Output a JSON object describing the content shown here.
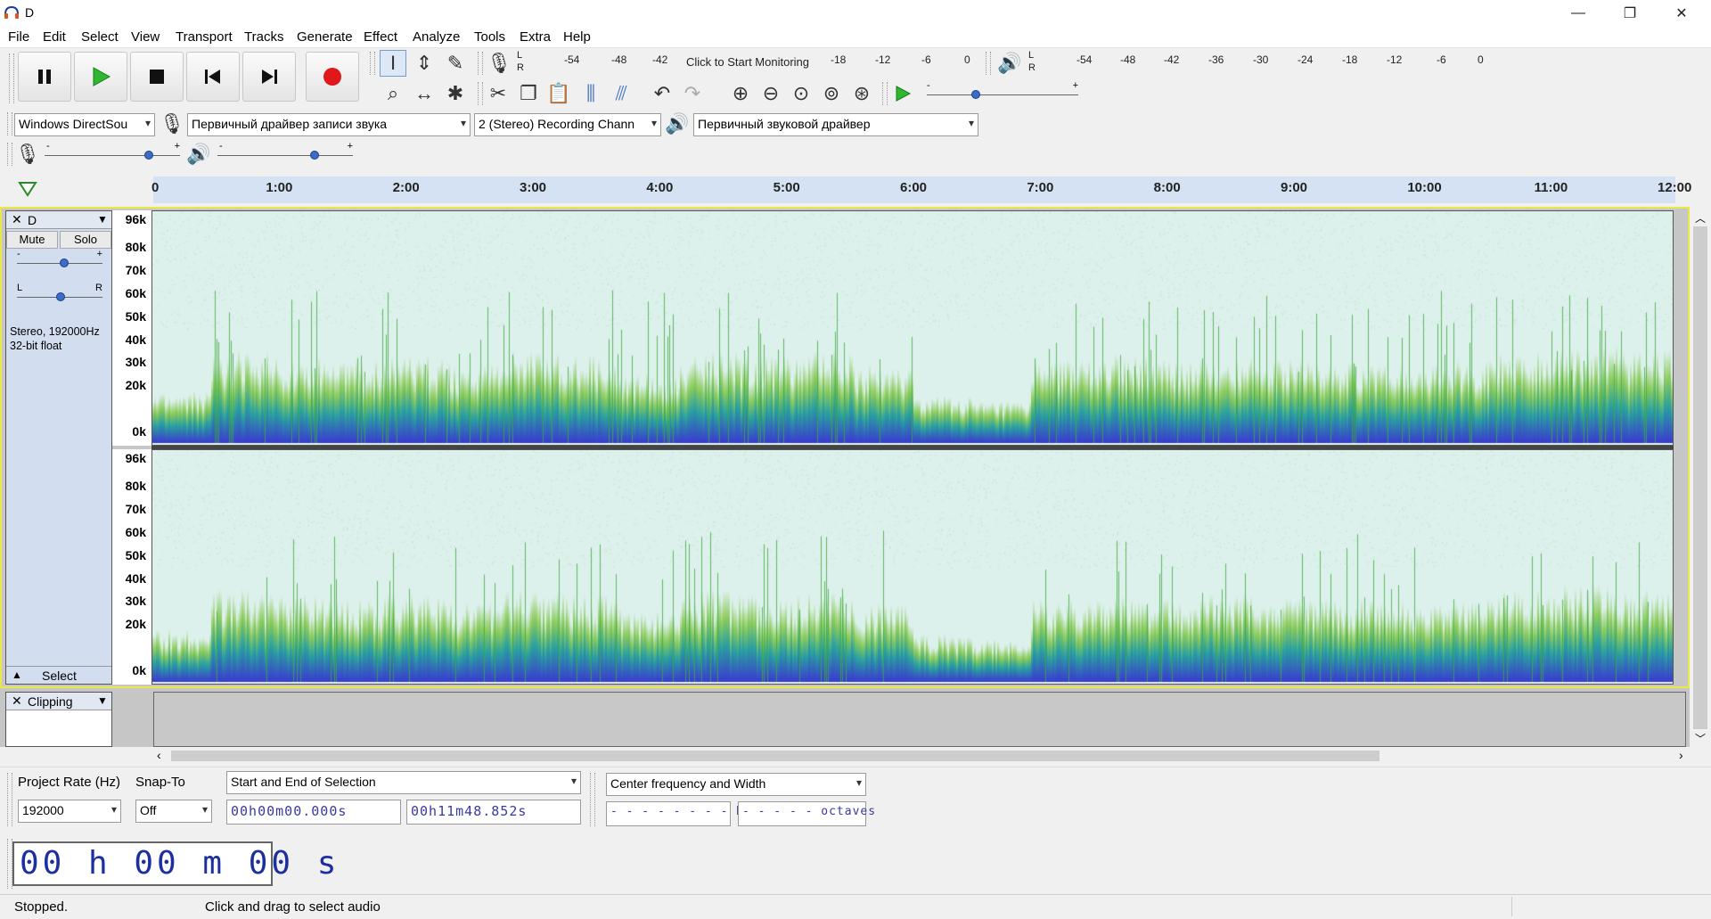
{
  "window": {
    "title": "D",
    "minimize": "—",
    "maximize": "❐",
    "close": "✕"
  },
  "menu": [
    "File",
    "Edit",
    "Select",
    "View",
    "Transport",
    "Tracks",
    "Generate",
    "Effect",
    "Analyze",
    "Tools",
    "Extra",
    "Help"
  ],
  "transport": {
    "pause": "pause-icon",
    "play": "play-icon",
    "stop": "stop-icon",
    "skip_start": "skip-start-icon",
    "skip_end": "skip-end-icon",
    "record": "record-icon"
  },
  "recording_meter": {
    "scale": [
      "-54",
      "-48",
      "-42",
      "-18",
      "-12",
      "-6",
      "0"
    ],
    "prompt": "Click to Start Monitoring",
    "channels": [
      "L",
      "R"
    ]
  },
  "playback_meter": {
    "scale": [
      "-54",
      "-48",
      "-42",
      "-36",
      "-30",
      "-24",
      "-18",
      "-12",
      "-6",
      "0"
    ],
    "channels": [
      "L",
      "R"
    ]
  },
  "play_speed": {
    "min": "-",
    "max": "+"
  },
  "devices": {
    "host": "Windows DirectSou",
    "recording_device": "Первичный драйвер записи звука",
    "channels": "2 (Stereo) Recording Chann",
    "playback_device": "Первичный звуковой драйвер"
  },
  "mixer": {
    "rec_min": "-",
    "rec_max": "+",
    "play_min": "-",
    "play_max": "+"
  },
  "timeline": {
    "ticks": [
      "0",
      "1:00",
      "2:00",
      "3:00",
      "4:00",
      "5:00",
      "6:00",
      "7:00",
      "8:00",
      "9:00",
      "10:00",
      "11:00",
      "12:00"
    ]
  },
  "track": {
    "name": "D",
    "mute": "Mute",
    "solo": "Solo",
    "gain_min": "-",
    "gain_max": "+",
    "pan_left": "L",
    "pan_right": "R",
    "info_line1": "Stereo, 192000Hz",
    "info_line2": "32-bit float",
    "select": "Select",
    "freq_labels": [
      "96k",
      "80k",
      "70k",
      "60k",
      "50k",
      "40k",
      "30k",
      "20k",
      "0k"
    ]
  },
  "label_track": {
    "name": "Clipping"
  },
  "selection_toolbar": {
    "project_rate_label": "Project Rate (Hz)",
    "project_rate": "192000",
    "snap_to_label": "Snap-To",
    "snap_to": "Off",
    "selection_mode": "Start and End of Selection",
    "start": "00h00m00.000s",
    "end": "00h11m48.852s"
  },
  "spectral_toolbar": {
    "mode": "Center frequency and Width",
    "center": "- - - - - - - - Hz",
    "width": "- - - - - octaves"
  },
  "audio_position": "00 h 00 m 00 s",
  "status": {
    "state": "Stopped.",
    "hint": "Click and drag to select audio"
  },
  "colors": {
    "accent": "#3a6cc8",
    "spectrogram_bg": "#dcf0ec",
    "spectrogram_low": "#3a3ad0",
    "spectrogram_mid": "#2aa0a0",
    "spectrogram_high": "#8ccc5c",
    "selection_band": "#d5e2f4"
  },
  "spectrogram_activity": [
    0.15,
    0.6,
    0.55,
    0.5,
    0.55,
    0.45,
    0.6,
    0.55,
    0.35,
    0.6,
    0.55,
    0.6,
    0.45,
    0.1,
    0.05,
    0.5,
    0.55,
    0.5,
    0.55,
    0.5,
    0.5,
    0.45,
    0.5,
    0.6,
    0.65,
    0.6
  ]
}
